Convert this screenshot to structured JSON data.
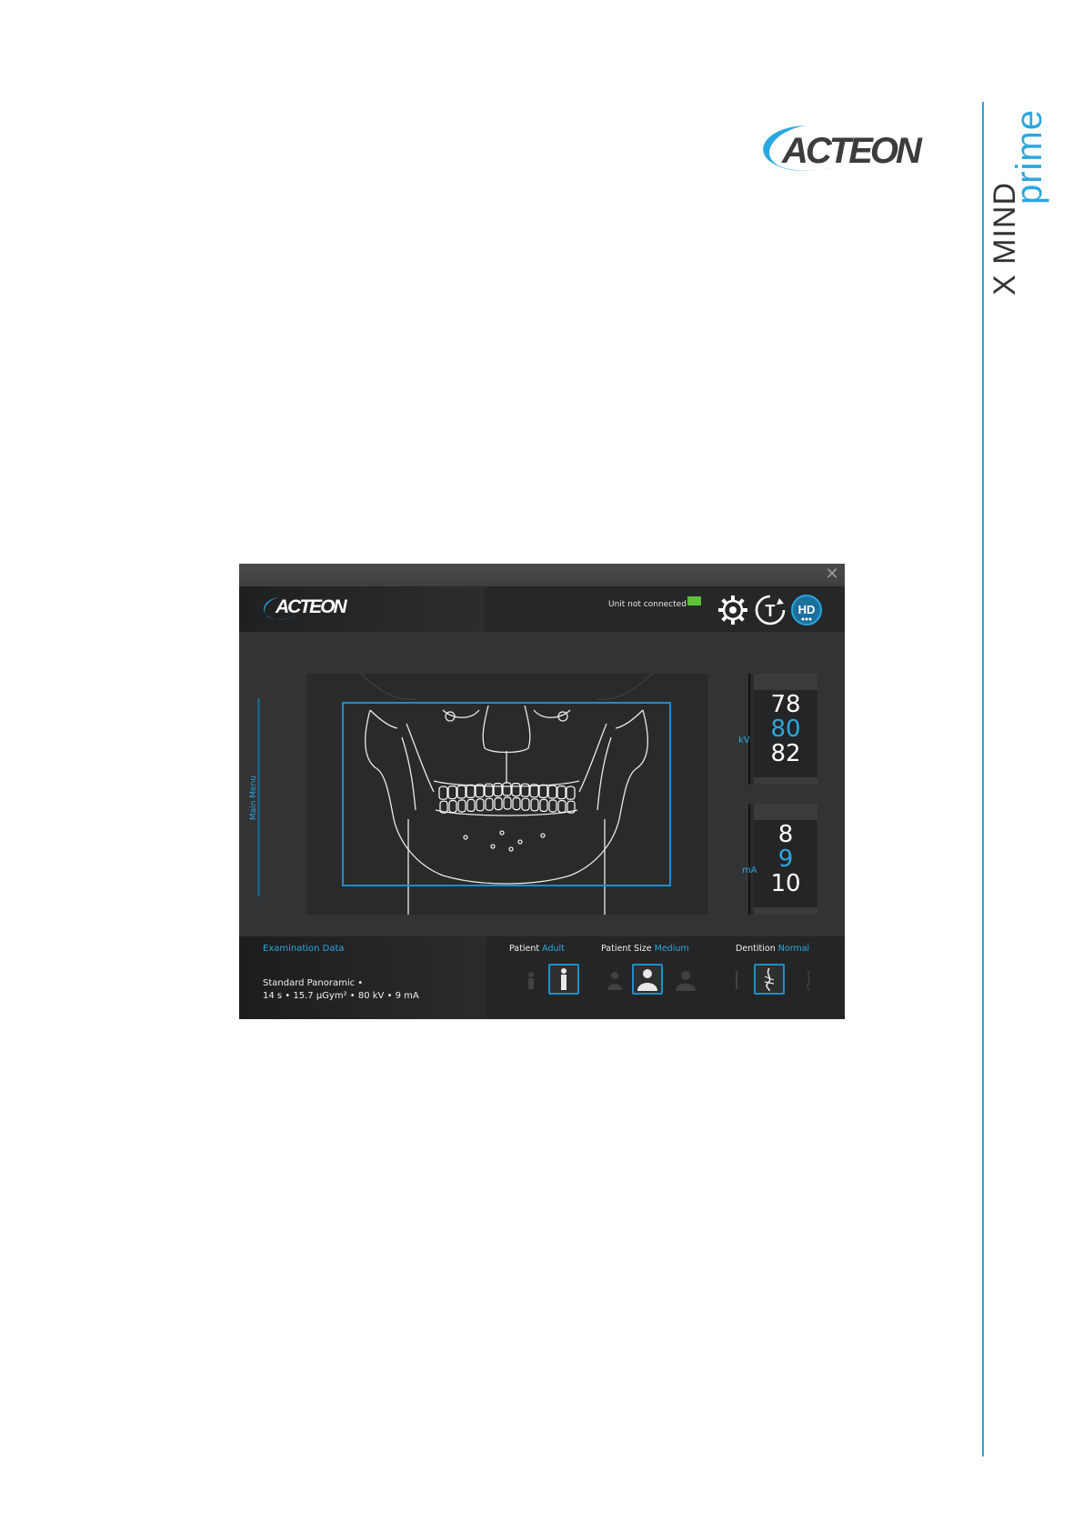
{
  "page": {
    "brand_logo_text": "ACTEON",
    "product_name_part1": "X MIND",
    "product_name_part2": "prime",
    "colors": {
      "accent": "#2aa7e0",
      "led_green": "#5cc23a"
    }
  },
  "window": {
    "close_icon": "close-icon",
    "header": {
      "logo_text": "ACTEON",
      "connection_status": "Unit not connected",
      "icons": [
        "gear-icon",
        "timer-reset-icon",
        "hd-icon"
      ]
    },
    "sidebar": {
      "main_menu_label": "Main Menu"
    },
    "kv_dial": {
      "unit": "kV",
      "values": [
        "78",
        "80",
        "82"
      ],
      "selected": "80"
    },
    "ma_dial": {
      "unit": "mA",
      "values": [
        "8",
        "9",
        "10"
      ],
      "selected": "9"
    },
    "exam": {
      "title": "Examination Data",
      "line1": "Standard Panoramic •",
      "line2": "14 s • 15.7 µGym² • 80 kV • 9 mA"
    },
    "options": {
      "patient": {
        "label": "Patient",
        "value": "Adult"
      },
      "patient_size": {
        "label": "Patient Size",
        "value": "Medium"
      },
      "dentition": {
        "label": "Dentition",
        "value": "Normal"
      }
    }
  }
}
